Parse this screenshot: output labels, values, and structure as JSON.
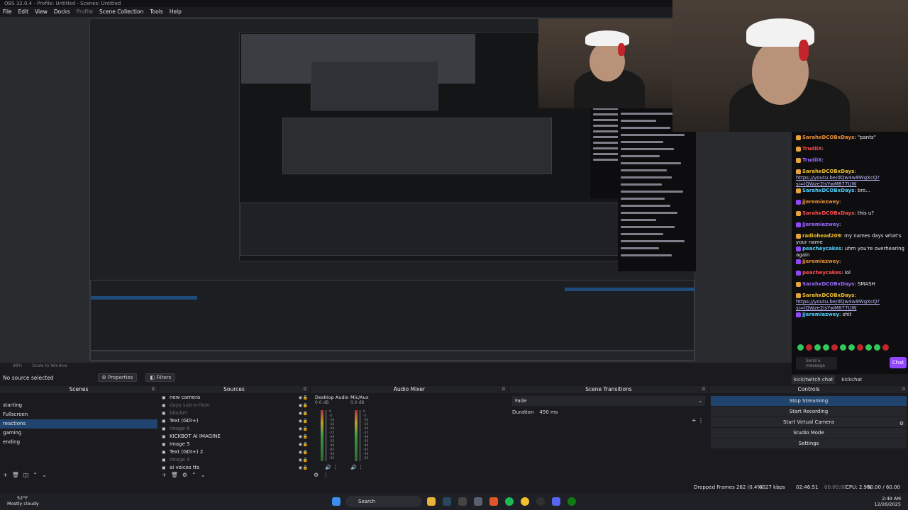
{
  "window": {
    "title": "OBS 32.0.4 - Profile: Untitled - Scenes: Untitled"
  },
  "menu": [
    "File",
    "Edit",
    "View",
    "Docks",
    "Profile",
    "Scene Collection",
    "Tools",
    "Help"
  ],
  "preview": {
    "zoom_label": "88%",
    "scale_label": "Scale to Window"
  },
  "chat": {
    "lines": [
      {
        "user": "SarahxDCOBxDays",
        "msg": "\"pants\""
      },
      {
        "user": "TrudiiX",
        "msg": ""
      },
      {
        "user": "TrudiiX",
        "msg": ""
      },
      {
        "user": "SarahxDCOBxDays",
        "msg": "",
        "link": "https://youtu.be/dQw4w9WgXcQ?si=lQWze2IsYwM877UW"
      },
      {
        "user": "SarahxDCOBxDays",
        "msg": "bro..."
      },
      {
        "user": "jjeremiezwey",
        "msg": ""
      },
      {
        "user": "SarahxDCOBxDays",
        "msg": "this u?"
      },
      {
        "user": "jjeremiezwey",
        "msg": ""
      },
      {
        "user": "radiohead209",
        "msg": "my names days what's your name"
      },
      {
        "user": "peacheycakes",
        "msg": "uhm you're overhearing again"
      },
      {
        "user": "jjeremiezwey",
        "msg": ""
      },
      {
        "user": "peacheycakes",
        "msg": "lol"
      },
      {
        "user": "SarahxDCOBxDays",
        "msg": "SMASH"
      },
      {
        "user": "SarahxDCOBxDays",
        "msg": "",
        "link": "https://youtu.be/dQw4w9WgXcQ?si=lQWze2IsYwM877UW"
      },
      {
        "user": "jjeremiezwey",
        "msg": "shit"
      }
    ],
    "input_placeholder": "Send a message",
    "send_label": "Chat",
    "tabs": [
      "kick/twitch chat",
      "kickchat"
    ]
  },
  "properties_bar": {
    "no_source": "No source selected",
    "properties_label": "Properties",
    "filters_label": "Filters"
  },
  "scenes": {
    "title": "Scenes",
    "items": [
      "starting",
      "Fullscreen",
      "reactions",
      "gaming",
      "ending"
    ],
    "selected": "reactions"
  },
  "sources": {
    "title": "Sources",
    "items": [
      {
        "label": "new camera",
        "hidden": false
      },
      {
        "label": "days sub-a-thon",
        "hidden": true
      },
      {
        "label": "blocker",
        "hidden": true
      },
      {
        "label": "Text (GDI+)",
        "hidden": false
      },
      {
        "label": "Image 6",
        "hidden": true
      },
      {
        "label": "KICKBOT AI IMAGINE",
        "hidden": false
      },
      {
        "label": "Image 5",
        "hidden": false
      },
      {
        "label": "Text (GDI+) 2",
        "hidden": false
      },
      {
        "label": "Image 4",
        "hidden": true
      },
      {
        "label": "ai voices tts",
        "hidden": false
      }
    ]
  },
  "audio_mixer": {
    "title": "Audio Mixer",
    "channels": [
      {
        "name": "Desktop Audio",
        "db": "0.0 dB"
      },
      {
        "name": "Mic/Aux",
        "db": "0.0 dB"
      }
    ],
    "ticks": [
      "0",
      "-5",
      "-10",
      "-15",
      "-20",
      "-25",
      "-30",
      "-35",
      "-40",
      "-45",
      "-50",
      "-55",
      "-60"
    ]
  },
  "transitions": {
    "title": "Scene Transitions",
    "type": "Fade",
    "duration_label": "Duration",
    "duration_value": "450 ms"
  },
  "controls": {
    "title": "Controls",
    "buttons": [
      "Stop Streaming",
      "Start Recording",
      "Start Virtual Camera",
      "Studio Mode",
      "Settings"
    ]
  },
  "status": {
    "dropped": "Dropped Frames 262 (0.4%)",
    "bitrate": "8027 kbps",
    "stream_time": "02:46:51",
    "rec_time": "00:00:00",
    "cpu": "CPU: 2.9%",
    "fps": "60.00 / 60.00 FPS"
  },
  "taskbar": {
    "weather_temp": "52°F",
    "weather_desc": "Mostly cloudy",
    "search_label": "Search",
    "time": "2:49 AM",
    "date": "12/26/2025"
  },
  "colors": {
    "accent": "#20446e",
    "chat_button": "#9147ff",
    "live_green": "#34c759"
  }
}
